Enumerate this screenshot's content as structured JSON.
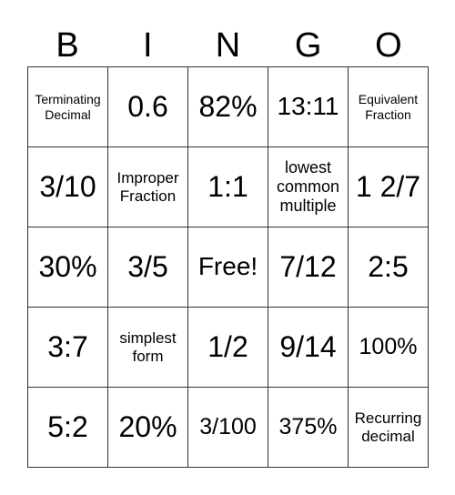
{
  "header": [
    "B",
    "I",
    "N",
    "G",
    "O"
  ],
  "cells": [
    [
      "Terminating\nDecimal",
      "0.6",
      "82%",
      "13:11",
      "Equivalent\nFraction"
    ],
    [
      "3/10",
      "Improper\nFraction",
      "1:1",
      "lowest\ncommon\nmultiple",
      "1 2/7"
    ],
    [
      "30%",
      "3/5",
      "Free!",
      "7/12",
      "2:5"
    ],
    [
      "3:7",
      "simplest\nform",
      "1/2",
      "9/14",
      "100%"
    ],
    [
      "5:2",
      "20%",
      "3/100",
      "375%",
      "Recurring\ndecimal"
    ]
  ]
}
